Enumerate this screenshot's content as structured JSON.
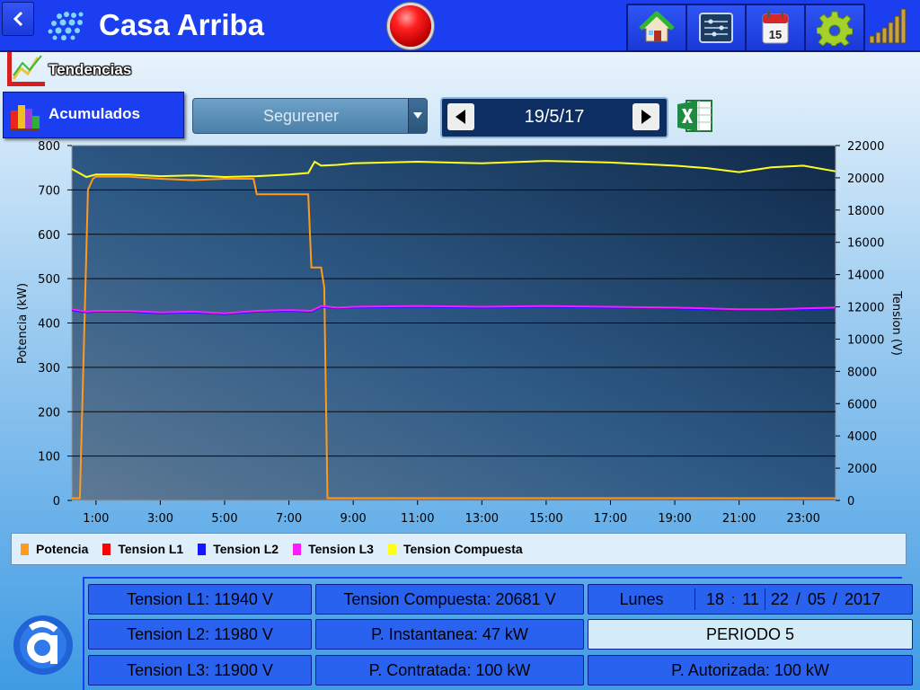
{
  "header": {
    "title": "Casa Arriba",
    "toolbar": [
      "home-icon",
      "sliders-icon",
      "calendar-icon",
      "gear-icon"
    ],
    "calendar_day": "15"
  },
  "tendencias": {
    "label": "Tendencias"
  },
  "acumulados": {
    "label": "Acumulados"
  },
  "selector": {
    "value": "Segurener"
  },
  "date_nav": {
    "date": "19/5/17"
  },
  "chart_data": {
    "type": "line",
    "x_ticks": [
      "1:00",
      "3:00",
      "5:00",
      "7:00",
      "9:00",
      "11:00",
      "13:00",
      "15:00",
      "17:00",
      "19:00",
      "21:00",
      "23:00"
    ],
    "y_left": {
      "label": "Potencia (kW)",
      "ticks": [
        "800",
        "700",
        "600",
        "500",
        "400",
        "300",
        "200",
        "100",
        "0"
      ],
      "range": [
        0,
        800
      ]
    },
    "y_right": {
      "label": "Tension (V)",
      "ticks": [
        "22000",
        "20000",
        "18000",
        "16000",
        "14000",
        "12000",
        "10000",
        "8000",
        "6000",
        "4000",
        "2000",
        "0"
      ],
      "range": [
        0,
        22000
      ]
    },
    "x_range": [
      0.25,
      24
    ],
    "series": [
      {
        "name": "Potencia",
        "color": "#ff9a1a",
        "axis": "left",
        "x": [
          0.25,
          0.5,
          0.65,
          0.75,
          0.9,
          1,
          2,
          3,
          4,
          5,
          5.9,
          6,
          7,
          7.6,
          7.7,
          8,
          8.1,
          8.2,
          9,
          12,
          15,
          18,
          21,
          24
        ],
        "y": [
          5,
          5,
          420,
          700,
          725,
          730,
          730,
          725,
          722,
          725,
          725,
          690,
          690,
          690,
          525,
          525,
          480,
          5,
          5,
          5,
          5,
          5,
          5,
          5
        ]
      },
      {
        "name": "Tension L1",
        "color": "#ff0000",
        "axis": "right",
        "x": [],
        "y": []
      },
      {
        "name": "Tension L2",
        "color": "#1515ff",
        "axis": "right",
        "x": [
          0.25,
          0.7,
          1,
          2,
          3,
          4,
          5,
          6,
          7,
          7.7,
          8,
          8.5,
          9,
          11,
          13,
          15,
          17,
          19,
          21,
          22,
          24
        ],
        "y": [
          11800,
          11650,
          11700,
          11700,
          11600,
          11650,
          11550,
          11700,
          11750,
          11700,
          12000,
          11900,
          11950,
          12000,
          11950,
          12000,
          11950,
          11900,
          11800,
          11800,
          11900
        ]
      },
      {
        "name": "Tension L3",
        "color": "#ff19ff",
        "axis": "right",
        "x": [
          0.25,
          0.7,
          1,
          2,
          3,
          4,
          5,
          6,
          7,
          7.7,
          8,
          8.5,
          9,
          11,
          13,
          15,
          17,
          19,
          21,
          22,
          24
        ],
        "y": [
          11850,
          11700,
          11750,
          11750,
          11650,
          11700,
          11600,
          11750,
          11800,
          11750,
          12050,
          11950,
          12000,
          12050,
          12000,
          12050,
          12000,
          11950,
          11850,
          11850,
          11950
        ]
      },
      {
        "name": "Tension Compuesta",
        "color": "#ffff1a",
        "axis": "right",
        "x": [
          0.25,
          0.7,
          1,
          2,
          3,
          4,
          5,
          6,
          7,
          7.6,
          7.8,
          8,
          8.5,
          9,
          10,
          11,
          13,
          15,
          17,
          19,
          20,
          21,
          22,
          23,
          24
        ],
        "y": [
          20550,
          20050,
          20200,
          20200,
          20100,
          20150,
          20050,
          20100,
          20200,
          20300,
          21000,
          20750,
          20800,
          20900,
          20950,
          21000,
          20900,
          21050,
          20950,
          20750,
          20600,
          20350,
          20650,
          20750,
          20400
        ]
      }
    ]
  },
  "legend": [
    {
      "name": "Potencia",
      "color": "#ff9a1a"
    },
    {
      "name": "Tension L1",
      "color": "#ff0000"
    },
    {
      "name": "Tension L2",
      "color": "#1515ff"
    },
    {
      "name": "Tension L3",
      "color": "#ff19ff"
    },
    {
      "name": "Tension Compuesta",
      "color": "#ffff1a"
    }
  ],
  "status": {
    "tension_l1": "Tension L1: 11940 V",
    "tension_l2": "Tension L2: 11980 V",
    "tension_l3": "Tension L3: 11900 V",
    "tension_compuesta": "Tension Compuesta: 20681 V",
    "p_instantanea": "P. Instantanea: 47 kW",
    "p_contratada": "P. Contratada: 100 kW",
    "day": "Lunes",
    "hour": "18",
    "time_sep": ":",
    "minute": "11",
    "date_day": "22",
    "date_month": "05",
    "date_year": "2017",
    "date_sep": "/",
    "periodo": "PERIODO 5",
    "p_autorizada": "P. Autorizada: 100 kW"
  }
}
